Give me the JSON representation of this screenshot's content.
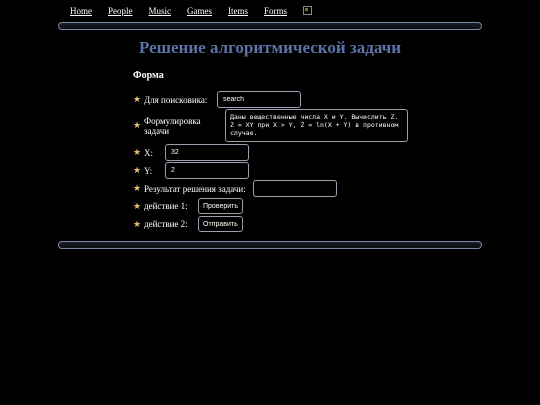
{
  "nav": {
    "items": [
      "Home",
      "People",
      "Music",
      "Games",
      "Items",
      "Forms"
    ]
  },
  "page": {
    "title": "Решение алгоритмической задачи",
    "form_heading": "Форма"
  },
  "form": {
    "search_label": "Для поисковика:",
    "search_value": "search",
    "task_label_line1": "Формулировка",
    "task_label_line2": "задачи",
    "task_text": "Даны вещественные числа X и Y. Вычислить Z. Z = XY при X > Y, Z = ln(X + Y) в противном случае.",
    "x_label": "X:",
    "x_value": "32",
    "y_label": "Y:",
    "y_value": "2",
    "result_label": "Результат решения задачи:",
    "result_value": "",
    "action1_label": "действие 1:",
    "action1_button": "Проверить",
    "action2_label": "действие 2:",
    "action2_button": "Отправить"
  },
  "colors": {
    "background": "#000000",
    "title": "#5a74a8",
    "star": "#e8c070",
    "border": "#9aa0b0"
  }
}
